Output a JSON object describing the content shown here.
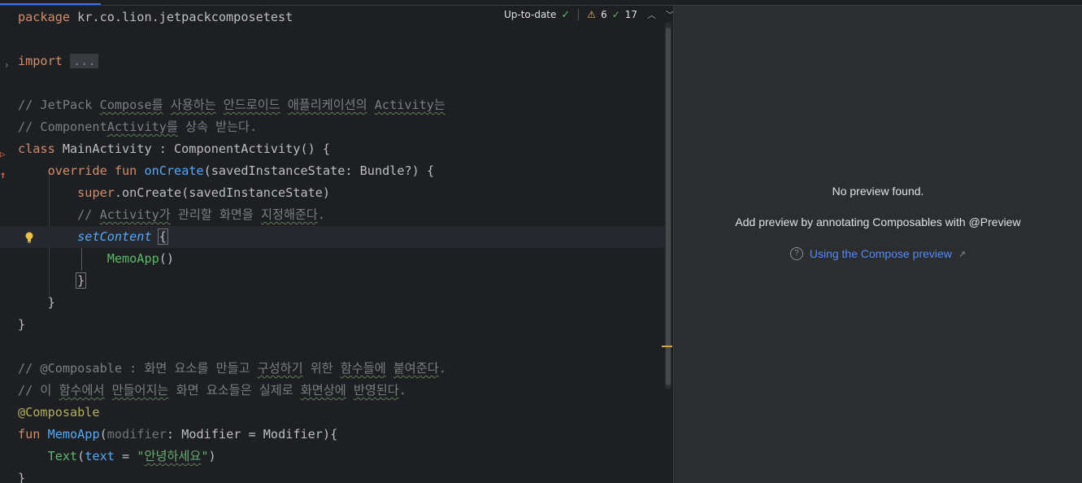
{
  "editor": {
    "status": {
      "up_to_date": "Up-to-date",
      "warnings_count": "6",
      "typos_count": "17"
    },
    "code": {
      "l1": {
        "kw": "package",
        "rest": " kr.co.lion.jetpackcomposetest"
      },
      "l2": {
        "kw": "import",
        "fold": "..."
      },
      "l3": {
        "prefix": "// JetPack ",
        "w1": "Compose를",
        "sp1": " ",
        "w2": "사용하는",
        "sp2": " ",
        "w3": "안드로이드",
        "sp3": " ",
        "w4": "애플리케이션의",
        "sp4": " ",
        "w5": "Activity는"
      },
      "l4": {
        "prefix": "// Component",
        "w1": "Activity를",
        "rest": " 상속 받는다."
      },
      "l5": {
        "kw": "class",
        "rest": " MainActivity : ComponentActivity() {"
      },
      "l6": {
        "kw1": "override",
        "kw2": "fun",
        "fn": "onCreate",
        "rest": "(savedInstanceState: Bundle?) {"
      },
      "l7": {
        "kw": "super",
        "rest": ".onCreate(savedInstanceState)"
      },
      "l8": {
        "prefix": "// ",
        "w1": "Activity가",
        "mid": " 관리할 화면을 ",
        "w2": "지정해준다",
        "end": "."
      },
      "l9": {
        "fn": "setContent",
        "brace": "{"
      },
      "l10": {
        "call": "MemoApp",
        "rest": "()"
      },
      "l11": {
        "brace": "}"
      },
      "l12": {
        "text": "}"
      },
      "l13": {
        "text": "}"
      },
      "l14": {
        "prefix": "// @Composable : 화면 요소를 만들고 ",
        "w1": "구성하기",
        "mid": " 위한 ",
        "w2": "함수들에",
        "sp": " ",
        "w3": "붙여준다",
        "end": "."
      },
      "l15": {
        "prefix": "// 이 ",
        "w1": "함수에서",
        "sp1": " ",
        "w2": "만들어지는",
        "mid": " 화면 요소들은 실제로 ",
        "w3": "화면상에",
        "sp2": " ",
        "w4": "반영된다",
        "end": "."
      },
      "l16": {
        "ann": "@Composable"
      },
      "l17": {
        "kw": "fun",
        "fn": "MemoApp",
        "p1": "(",
        "param": "modifier",
        "rest": ": Modifier = Modifier){"
      },
      "l18": {
        "call": "Text",
        "p1": "(",
        "named": "text",
        "eq": " = ",
        "str_open": "\"",
        "str_w": "안녕하세요",
        "str_close": "\"",
        "p2": ")"
      },
      "l19": {
        "text": "}"
      }
    }
  },
  "preview": {
    "title": "No preview found.",
    "subtitle": "Add preview by annotating Composables with @Preview",
    "link": "Using the Compose preview",
    "help_glyph": "?",
    "ext_glyph": "↗"
  },
  "icons": {
    "fold": "›",
    "run": "▷",
    "override": "↑",
    "nav_up": "︿",
    "nav_down": "﹀"
  },
  "colors": {
    "keyword": "#cf8e6d",
    "function": "#56a8f5",
    "comment": "#7a7e85",
    "string": "#6aab73",
    "annotation": "#b3ae60",
    "link": "#548af7",
    "background": "#1e1f22",
    "preview_background": "#2b2d30"
  }
}
